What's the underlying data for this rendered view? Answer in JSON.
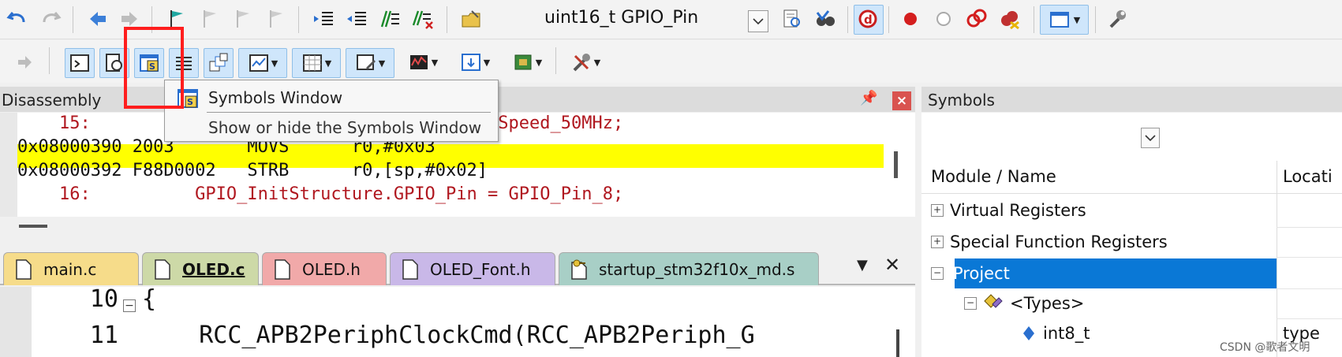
{
  "toolbar": {
    "target_text": "uint16_t GPIO_Pin"
  },
  "disassembly": {
    "title": "Disassembly",
    "lines": [
      {
        "kind": "src",
        "text": "    15:                         _Speed = GPIO_Speed_50MHz;"
      },
      {
        "kind": "asm",
        "text": "0x08000390 2003       MOVS      r0,#0x03"
      },
      {
        "kind": "asm",
        "text": "0x08000392 F88D0002   STRB      r0,[sp,#0x02]"
      },
      {
        "kind": "src",
        "text": "    16:          GPIO_InitStructure.GPIO_Pin = GPIO_Pin_8;"
      }
    ]
  },
  "tooltip": {
    "title": "Symbols Window",
    "description": "Show or hide the Symbols Window"
  },
  "editor": {
    "tabs": [
      {
        "label": "main.c",
        "color": "#f6dc8a"
      },
      {
        "label": "OLED.c",
        "color": "#cdd9a7"
      },
      {
        "label": "OLED.h",
        "color": "#f1a9a9"
      },
      {
        "label": "OLED_Font.h",
        "color": "#c9b8e8"
      },
      {
        "label": "startup_stm32f10x_md.s",
        "color": "#a8cfc6"
      }
    ],
    "lines": [
      {
        "num": "10",
        "text": "{"
      },
      {
        "num": "11",
        "text": "    RCC_APB2PeriphClockCmd(RCC_APB2Periph_G"
      }
    ]
  },
  "symbols": {
    "title": "Symbols",
    "col_name": "Module / Name",
    "col_location": "Locati",
    "tree": [
      {
        "label": "Virtual Registers",
        "expander": "+"
      },
      {
        "label": "Special Function Registers",
        "expander": "+"
      },
      {
        "label": "Project",
        "expander": "−"
      },
      {
        "label": "<Types>",
        "expander": "−"
      },
      {
        "label": "int8_t",
        "expander": ""
      }
    ],
    "row_type_value": "type"
  },
  "watermark": "CSDN @歌者文明"
}
